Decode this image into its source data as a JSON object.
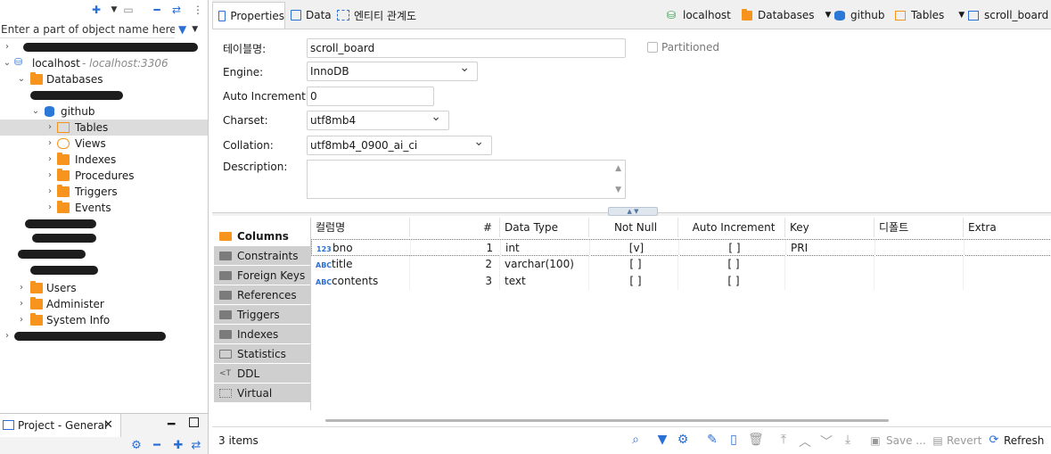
{
  "navigator": {
    "filter_placeholder": "Enter a part of object name here",
    "tree": {
      "host_label": "localhost",
      "host_sub": "- localhost:3306",
      "databases_label": "Databases",
      "github_label": "github",
      "tables_label": "Tables",
      "views_label": "Views",
      "indexes_label": "Indexes",
      "procedures_label": "Procedures",
      "triggers_label": "Triggers",
      "events_label": "Events",
      "users_label": "Users",
      "administer_label": "Administer",
      "system_info_label": "System Info"
    },
    "project_tab": "Project - General"
  },
  "editor": {
    "tabs": [
      {
        "label": "Properties"
      },
      {
        "label": "Data"
      },
      {
        "label": "엔티티 관계도"
      }
    ],
    "breadcrumb": {
      "host": "localhost",
      "databases": "Databases",
      "db": "github",
      "tables": "Tables",
      "table": "scroll_board"
    },
    "form": {
      "table_name_label": "테이블명:",
      "table_name_value": "scroll_board",
      "partitioned_label": "Partitioned",
      "engine_label": "Engine:",
      "engine_value": "InnoDB",
      "auto_inc_label": "Auto Increment:",
      "auto_inc_value": "0",
      "charset_label": "Charset:",
      "charset_value": "utf8mb4",
      "collation_label": "Collation:",
      "collation_value": "utf8mb4_0900_ai_ci",
      "description_label": "Description:"
    },
    "subtabs": [
      {
        "label": "Columns"
      },
      {
        "label": "Constraints"
      },
      {
        "label": "Foreign Keys"
      },
      {
        "label": "References"
      },
      {
        "label": "Triggers"
      },
      {
        "label": "Indexes"
      },
      {
        "label": "Statistics"
      },
      {
        "label": "DDL"
      },
      {
        "label": "Virtual"
      }
    ],
    "grid": {
      "headers": {
        "name": "컬럼명",
        "num": "#",
        "type": "Data Type",
        "notnull": "Not Null",
        "autoinc": "Auto Increment",
        "key": "Key",
        "default": "디폴트",
        "extra": "Extra"
      },
      "rows": [
        {
          "icon": "123",
          "name": "bno",
          "num": "1",
          "type": "int",
          "notnull": "[v]",
          "autoinc": "[ ]",
          "key": "PRI",
          "default": "",
          "extra": ""
        },
        {
          "icon": "ABC",
          "name": "title",
          "num": "2",
          "type": "varchar(100)",
          "notnull": "[ ]",
          "autoinc": "[ ]",
          "key": "",
          "default": "",
          "extra": ""
        },
        {
          "icon": "ABC",
          "name": "contents",
          "num": "3",
          "type": "text",
          "notnull": "[ ]",
          "autoinc": "[ ]",
          "key": "",
          "default": "",
          "extra": ""
        }
      ]
    },
    "status": {
      "items_count": "3 items",
      "save_label": "Save ...",
      "revert_label": "Revert",
      "refresh_label": "Refresh"
    }
  },
  "icons": {
    "accent": "#2a6fd6",
    "folder": "#f7941d"
  }
}
